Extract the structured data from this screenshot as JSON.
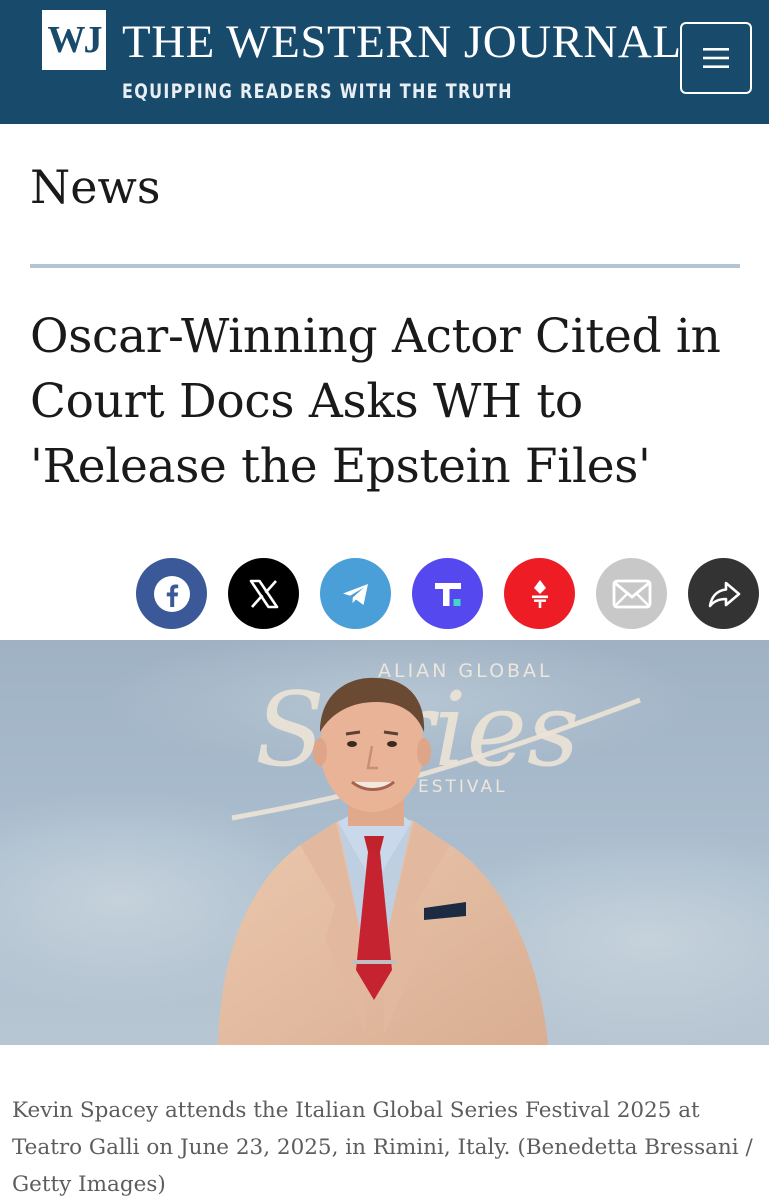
{
  "header": {
    "logo": "WJ",
    "title": "THE WESTERN JOURNAL",
    "tagline": "EQUIPPING READERS WITH THE TRUTH",
    "menu_icon": "hamburger-menu-icon"
  },
  "section": {
    "label": "News"
  },
  "article": {
    "headline": "Oscar-Winning Actor Cited in Court Docs Asks WH to 'Release the Epstein Files'"
  },
  "share": [
    {
      "name": "facebook",
      "icon": "facebook-icon",
      "color": "#3b5998"
    },
    {
      "name": "x",
      "icon": "x-icon",
      "color": "#000000"
    },
    {
      "name": "telegram",
      "icon": "telegram-icon",
      "color": "#4a9fd8"
    },
    {
      "name": "truth-social",
      "icon": "truth-social-icon",
      "color": "#5448ee"
    },
    {
      "name": "gettr",
      "icon": "gettr-icon",
      "color": "#ee1c25"
    },
    {
      "name": "email",
      "icon": "email-icon",
      "color": "#c8c8c8"
    },
    {
      "name": "share",
      "icon": "share-icon",
      "color": "#333333"
    }
  ],
  "image": {
    "backdrop_text_top": "ALIAN GLOBAL",
    "backdrop_script": "Series",
    "backdrop_text_bottom": "ESTIVAL",
    "caption": "Kevin Spacey attends the Italian Global Series Festival 2025 at Teatro Galli on June 23, 2025, in Rimini, Italy. (Benedetta Bressani / Getty Images)"
  },
  "colors": {
    "header_bg": "#174a6b",
    "rule": "#b4c4d2",
    "caption_text": "#5d5d5d"
  }
}
